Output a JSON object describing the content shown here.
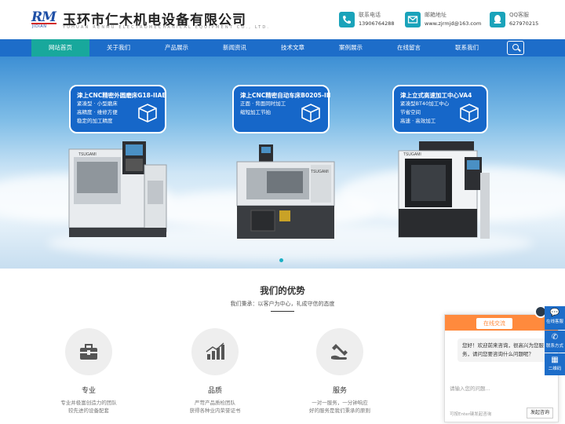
{
  "header": {
    "logo_text": "RM",
    "logo_sub": "JIDIAN",
    "company_name": "玉环市仁木机电设备有限公司",
    "company_en": "YUHUAN RENMU ELECTROMECHANICAL EQUIPMENT CO., LTD.",
    "contacts": [
      {
        "icon": "phone-icon",
        "label": "联系电话",
        "value": "13906764288"
      },
      {
        "icon": "mail-icon",
        "label": "邮箱地址",
        "value": "www.zjrmjd@163.com"
      },
      {
        "icon": "qq-icon",
        "label": "QQ客服",
        "value": "627970215"
      }
    ]
  },
  "nav": {
    "items": [
      "网站首页",
      "关于我们",
      "产品展示",
      "新闻资讯",
      "技术文章",
      "案例展示",
      "在线留言",
      "联系我们"
    ],
    "active": "网站首页",
    "search_icon": "search-icon",
    "active_color": "#18a89c",
    "bar_color": "#1d6dc9"
  },
  "banner": {
    "cards": [
      {
        "title": "津上CNC精密外圆磨床G18-IIAB",
        "lines": [
          "紧凑型 · 小型磨床",
          "高精度 · 维修方便",
          "稳定的加工精度"
        ]
      },
      {
        "title": "津上CNC精密自动车床B0205-III",
        "lines": [
          "正面 · 背面同时加工",
          "缩短加工节拍"
        ]
      },
      {
        "title": "津上立式高速加工中心VA4",
        "lines": [
          "紧凑型BT40加工中心",
          "节省空间",
          "高速 · 高效加工"
        ]
      }
    ],
    "machine_brand": "TSUGAMI"
  },
  "advantages": {
    "title": "我们的优势",
    "subtitle": "我们秉承：以客户为中心，礼成守信的态度",
    "items": [
      {
        "icon": "toolbox-icon",
        "name": "专业",
        "desc": [
          "专业并极富创造力的团队",
          "较先进的设备配套"
        ]
      },
      {
        "icon": "chart-icon",
        "name": "品质",
        "desc": [
          "严苛产品质检团队",
          "获得各种业内荣誉证书"
        ]
      },
      {
        "icon": "service-icon",
        "name": "服务",
        "desc": [
          "一对一服务，一分钟响应",
          "好的服务是我们秉承的原则"
        ]
      }
    ]
  },
  "chat": {
    "tab": "在线交流",
    "message": "您好！欢迎前来咨询，很高兴为您服务，请问您要咨询什么问题呢？",
    "placeholder": "请输入您的问题...",
    "hint": "可按Enter键发起咨询",
    "send": "发起咨询"
  },
  "side": {
    "items": [
      {
        "icon": "chat-icon",
        "label": "在线客服"
      },
      {
        "icon": "phone-icon",
        "label": "联系方式"
      },
      {
        "icon": "qrcode-icon",
        "label": "二维码"
      }
    ]
  }
}
